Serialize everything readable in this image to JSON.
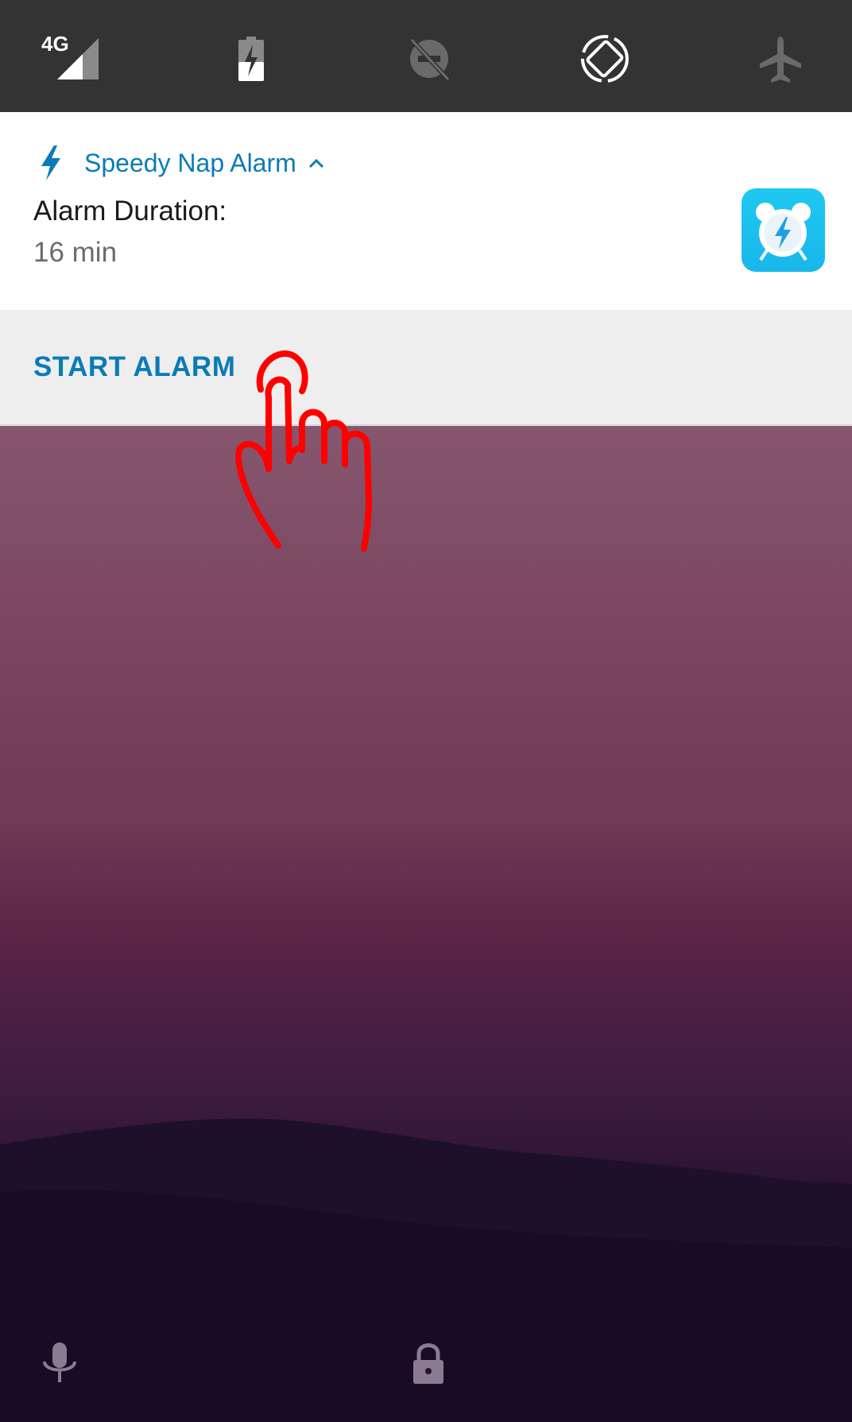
{
  "quick_settings": {
    "network_label": "4G",
    "icons": [
      "signal-4g-icon",
      "battery-charging-icon",
      "data-saver-off-icon",
      "auto-rotate-icon",
      "airplane-mode-icon"
    ]
  },
  "notification": {
    "app_name": "Speedy Nap Alarm",
    "title": "Alarm Duration:",
    "text": "16 min",
    "action_label": "START ALARM",
    "accent_color": "#0b7bb5",
    "icon_color": "#1ec8f0"
  },
  "bottom_bar": {
    "icons": [
      "microphone-icon",
      "lock-icon"
    ]
  },
  "overlay": {
    "icon": "tap-hand-icon",
    "color": "#ff0000"
  }
}
